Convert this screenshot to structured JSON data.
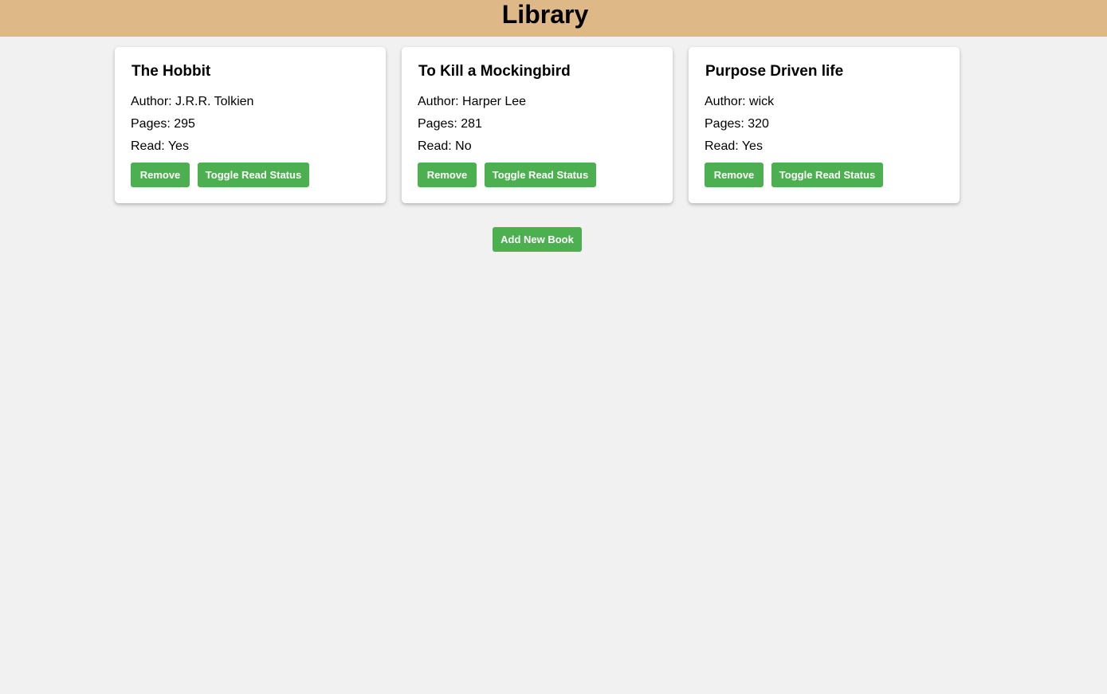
{
  "header": {
    "title": "Library"
  },
  "books": [
    {
      "title": "The Hobbit",
      "author": "Author: J.R.R. Tolkien",
      "pages": "Pages: 295",
      "read": "Read: Yes",
      "remove_label": "Remove",
      "toggle_label": "Toggle Read Status"
    },
    {
      "title": "To Kill a Mockingbird",
      "author": "Author: Harper Lee",
      "pages": "Pages: 281",
      "read": "Read: No",
      "remove_label": "Remove",
      "toggle_label": "Toggle Read Status"
    },
    {
      "title": "Purpose Driven life",
      "author": "Author: wick",
      "pages": "Pages: 320",
      "read": "Read: Yes",
      "remove_label": "Remove",
      "toggle_label": "Toggle Read Status"
    }
  ],
  "actions": {
    "add_book_label": "Add New Book"
  },
  "colors": {
    "header_bg": "#deb887",
    "page_bg": "#f1f1f1",
    "button_bg": "#4caf50"
  }
}
